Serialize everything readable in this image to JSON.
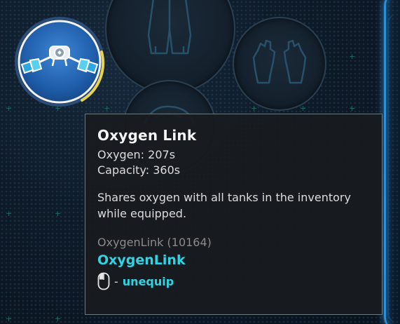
{
  "equipment_slots": [
    {
      "name": "suit-slot",
      "icon": "suit-icon"
    },
    {
      "name": "gloves-slot",
      "icon": "gloves-icon"
    },
    {
      "name": "helmet-slot",
      "icon": "helmet-icon"
    },
    {
      "name": "oxygen-link-slot",
      "icon": "oxygen-link-icon",
      "oxygen_fraction": 0.575
    }
  ],
  "tooltip": {
    "title": "Oxygen Link",
    "oxygen": "Oxygen: 207s",
    "capacity": "Capacity: 360s",
    "description": "Shares oxygen with all tanks in the inventory while equipped.",
    "item_id": "OxygenLink (10164)",
    "item_name": "OxygenLink",
    "action_icon": "mouse-left-click-icon",
    "action_dash": "-",
    "action_label": "unequip"
  },
  "colors": {
    "accent_cyan": "#2fd4e4",
    "oxygen_ring": "#e8d34a",
    "edge_glow": "#2d8fd4"
  }
}
